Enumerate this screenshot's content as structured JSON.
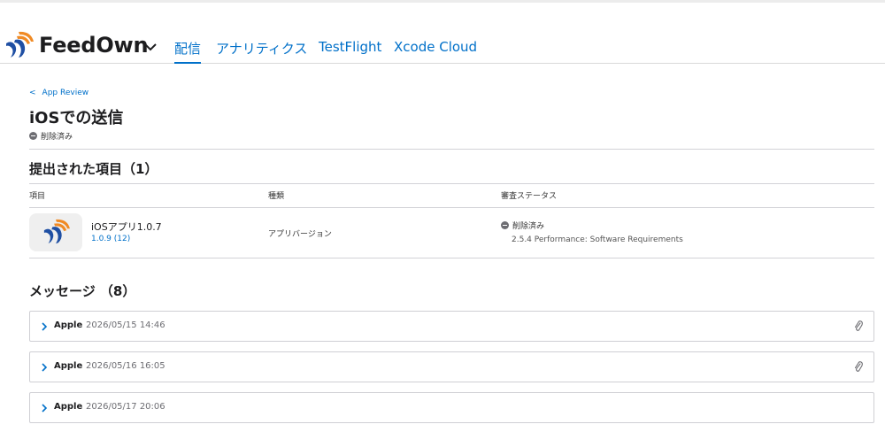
{
  "header": {
    "app_name": "FeedOwn",
    "tabs": [
      {
        "label": "配信",
        "active": true
      },
      {
        "label": "アナリティクス",
        "active": false
      },
      {
        "label": "TestFlight",
        "active": false
      },
      {
        "label": "Xcode Cloud",
        "active": false
      }
    ]
  },
  "breadcrumb": {
    "label": "App Review"
  },
  "page": {
    "title": "iOSでの送信",
    "status": "削除済み"
  },
  "submitted": {
    "heading": "提出された項目（1）",
    "columns": [
      "項目",
      "種類",
      "審査ステータス"
    ],
    "item": {
      "name": "iOSアプリ1.0.7",
      "build": "1.0.9 (12)",
      "kind": "アプリバージョン",
      "status": "削除済み",
      "reason": "2.5.4 Performance: Software Requirements"
    }
  },
  "messages": {
    "heading": "メッセージ （8）",
    "items": [
      {
        "sender": "Apple",
        "date": "2026/05/15 14:46",
        "attachment": true
      },
      {
        "sender": "Apple",
        "date": "2026/05/16 16:05",
        "attachment": true
      },
      {
        "sender": "Apple",
        "date": "2026/05/17 20:06",
        "attachment": false
      }
    ]
  },
  "colors": {
    "accent": "#0070c9",
    "logo_blue": "#1f4fa3",
    "logo_orange": "#f08a24"
  }
}
